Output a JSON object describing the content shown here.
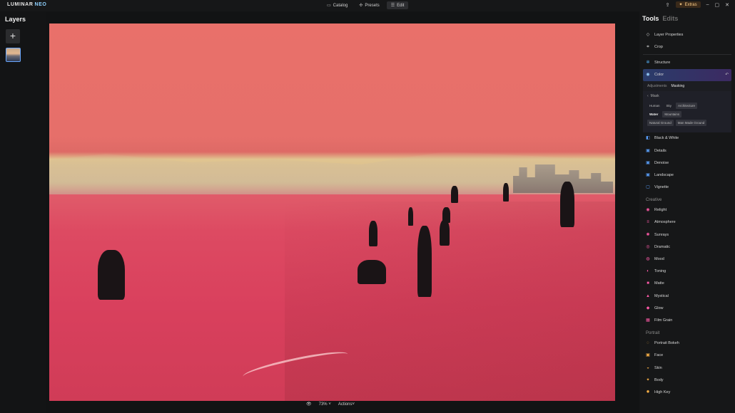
{
  "app": {
    "logo_main": "LUMINAR",
    "logo_accent": "NEO"
  },
  "nav": {
    "catalog": "Catalog",
    "presets": "Presets",
    "edit": "Edit"
  },
  "topright": {
    "extras": "Extras"
  },
  "layers": {
    "title": "Layers",
    "add": "+"
  },
  "canvas": {
    "zoom": "73%",
    "zoom_caret": "˅",
    "actions": "Actions˅"
  },
  "panel": {
    "tab_tools": "Tools",
    "tab_edits": "Edits",
    "essentials": [
      {
        "label": "Layer Properties",
        "icon": "layers-icon"
      },
      {
        "label": "Crop",
        "icon": "crop-icon"
      }
    ],
    "structure": "Structure",
    "color": "Color",
    "subtabs": {
      "adjustments": "Adjustments",
      "masking": "Masking"
    },
    "mask": {
      "title": "Mask",
      "row1": [
        "Human",
        "Sky",
        "Architecture"
      ],
      "row2": [
        "Water",
        "Mountains"
      ],
      "row3": [
        "Natural Ground",
        "Man Made Ground"
      ]
    },
    "more_tools": [
      "Black & White",
      "Details",
      "Denoise",
      "Landscape",
      "Vignette"
    ],
    "creative_header": "Creative",
    "creative": [
      "Relight",
      "Atmosphere",
      "Sunrays",
      "Dramatic",
      "Mood",
      "Toning",
      "Matte",
      "Mystical",
      "Glow",
      "Film Grain"
    ],
    "portrait_header": "Portrait",
    "portrait": [
      "Portrait Bokeh",
      "Face",
      "Skin",
      "Body",
      "High Key"
    ]
  },
  "colors": {
    "accent": "#6aa8ff",
    "mask_overlay": "#e0405c",
    "selected_tool": "#2a3c6a"
  }
}
